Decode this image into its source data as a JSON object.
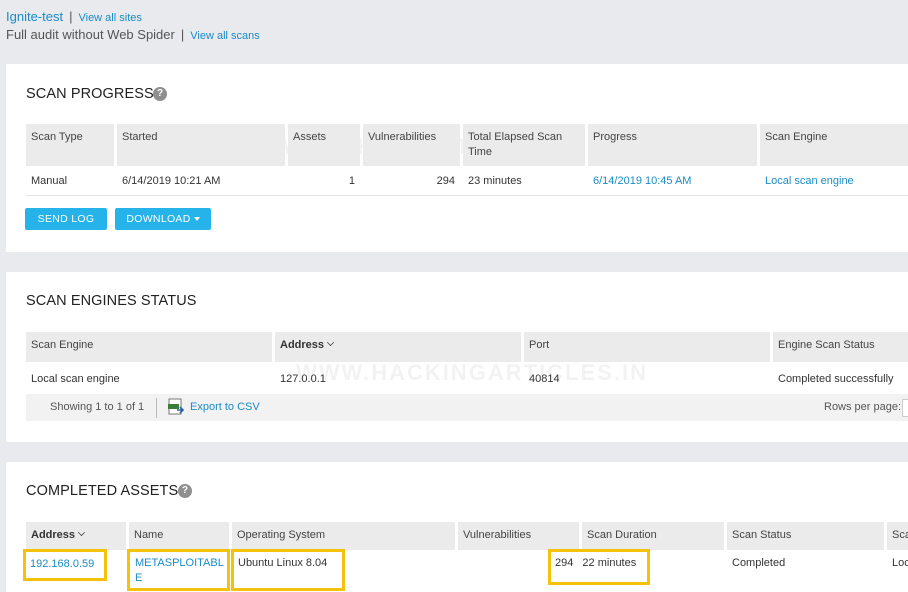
{
  "breadcrumb": {
    "site_name": "Ignite-test",
    "view_all_sites": "View all sites",
    "scan_name": "Full audit without Web Spider",
    "view_all_scans": "View all scans"
  },
  "watermark": "WWW.HACKINGARTICLES.IN",
  "scan_progress": {
    "title": "SCAN PROGRESS",
    "help": "?",
    "columns": [
      "Scan Type",
      "Started",
      "Assets",
      "Vulnerabilities",
      "Total Elapsed Scan Time",
      "Progress",
      "Scan Engine"
    ],
    "row": {
      "scan_type": "Manual",
      "started": "6/14/2019 10:21 AM",
      "assets": "1",
      "vulnerabilities": "294",
      "elapsed": "23 minutes",
      "progress": "6/14/2019 10:45 AM",
      "engine": "Local scan engine"
    },
    "send_log": "SEND LOG",
    "download": "DOWNLOAD"
  },
  "engines_status": {
    "title": "SCAN ENGINES STATUS",
    "columns": [
      "Scan Engine",
      "Address",
      "Port",
      "Engine Scan Status"
    ],
    "row": {
      "engine": "Local scan engine",
      "address": "127.0.0.1",
      "port": "40814",
      "status": "Completed successfully"
    },
    "showing": "Showing 1 to 1 of 1",
    "export": "Export to CSV",
    "rows_per_page": "Rows per page:"
  },
  "completed_assets": {
    "title": "COMPLETED ASSETS",
    "help": "?",
    "columns": [
      "Address",
      "Name",
      "Operating System",
      "Vulnerabilities",
      "Scan Duration",
      "Scan Status",
      "Sca"
    ],
    "row": {
      "address": "192.168.0.59",
      "name_line1": "METASPLOITABL",
      "name_line2": "E",
      "os": "Ubuntu Linux 8.04",
      "vulnerabilities": "294",
      "duration": "22 minutes",
      "status": "Completed",
      "engine": "Loc"
    }
  },
  "colors": {
    "accent": "#25b3ea",
    "link": "#1a8cc7",
    "highlight": "#f5c20b"
  }
}
